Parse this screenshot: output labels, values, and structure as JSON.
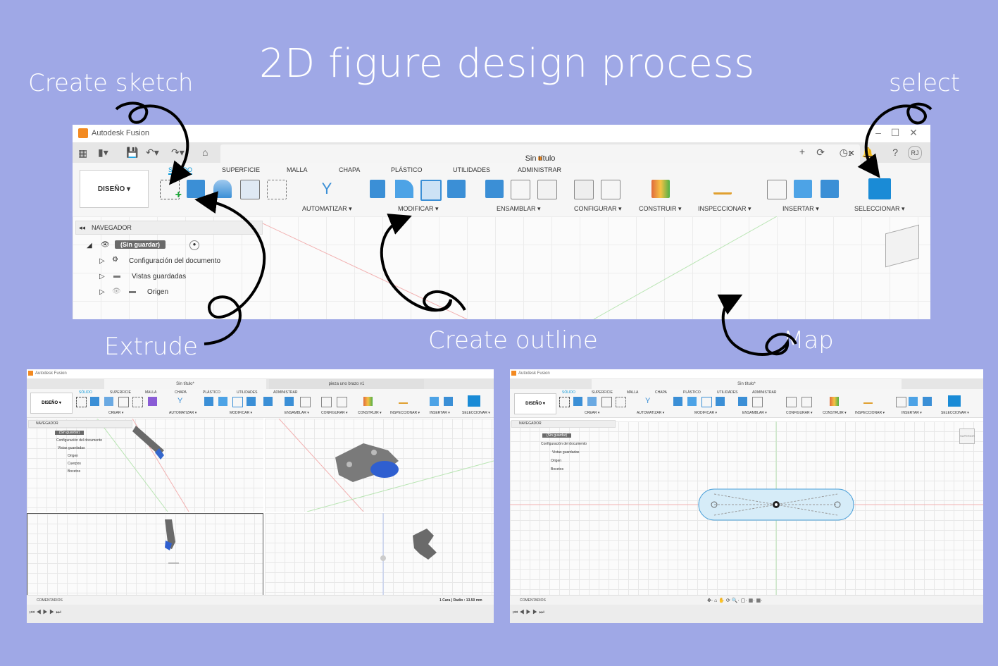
{
  "annotations": {
    "title": "2D figure design process",
    "create_sketch": "Create sketch",
    "select": "select",
    "extrude": "Extrude",
    "create_outline": "Create outline",
    "map": "Map"
  },
  "main_window": {
    "app_title": "Autodesk Fusion",
    "doc_tab": "Sin título",
    "user_initials": "RJ",
    "job_count": "1",
    "design_button": "DISEÑO",
    "ribbon_tabs": [
      "SÓLIDO",
      "SUPERFICIE",
      "MALLA",
      "CHAPA",
      "PLÁSTICO",
      "UTILIDADES",
      "ADMINISTRAR"
    ],
    "groups": [
      "AUTOMATIZAR",
      "MODIFICAR",
      "ENSAMBLAR",
      "CONFIGURAR",
      "CONSTRUIR",
      "INSPECCIONAR",
      "INSERTAR",
      "SELECCIONAR"
    ],
    "navigator": {
      "header": "NAVEGADOR",
      "root": "(Sin guardar)",
      "items": [
        "Configuración del documento",
        "Vistas guardadas",
        "Origen"
      ]
    }
  },
  "left_shot": {
    "app_title": "Autodesk Fusion",
    "doc_tab": "Sin título*",
    "doc_tab2": "pieza uno brazo v1",
    "design_button": "DISEÑO",
    "ribbon_tabs": [
      "SÓLIDO",
      "SUPERFICIE",
      "MALLA",
      "CHAPA",
      "PLÁSTICO",
      "UTILIDADES",
      "ADMINISTRAR"
    ],
    "groups": [
      "CREAR",
      "AUTOMATIZAR",
      "MODIFICAR",
      "ENSAMBLAR",
      "CONFIGURAR",
      "CONSTRUIR",
      "INSPECCIONAR",
      "INSERTAR",
      "SELECCIONAR"
    ],
    "navigator": {
      "header": "NAVEGADOR",
      "root": "(Sin guardar)",
      "items": [
        "Configuración del documento",
        "Vistas guardadas",
        "Origen",
        "Cuerpos",
        "Bocetos"
      ]
    },
    "comments": "COMENTARIOS",
    "status": "1 Cara | Radio : 13.50 mm"
  },
  "right_shot": {
    "app_title": "Autodesk Fusion",
    "doc_tab": "Sin título*",
    "design_button": "DISEÑO",
    "ribbon_tabs": [
      "SÓLIDO",
      "SUPERFICIE",
      "MALLA",
      "CHAPA",
      "PLÁSTICO",
      "UTILIDADES",
      "ADMINISTRAR"
    ],
    "groups": [
      "CREAR",
      "AUTOMATIZAR",
      "MODIFICAR",
      "ENSAMBLAR",
      "CONFIGURAR",
      "CONSTRUIR",
      "INSPECCIONAR",
      "INSERTAR",
      "SELECCIONAR"
    ],
    "navigator": {
      "header": "NAVEGADOR",
      "root": "(Sin guardar)",
      "items": [
        "Configuración del documento",
        "Vistas guardadas",
        "Origen",
        "Bocetos"
      ]
    },
    "comments": "COMENTARIOS",
    "viewcube_label": "SUPERIOR"
  },
  "colors": {
    "background": "#9fa8e6",
    "accent": "#0696d7",
    "brand": "#f38a21"
  }
}
